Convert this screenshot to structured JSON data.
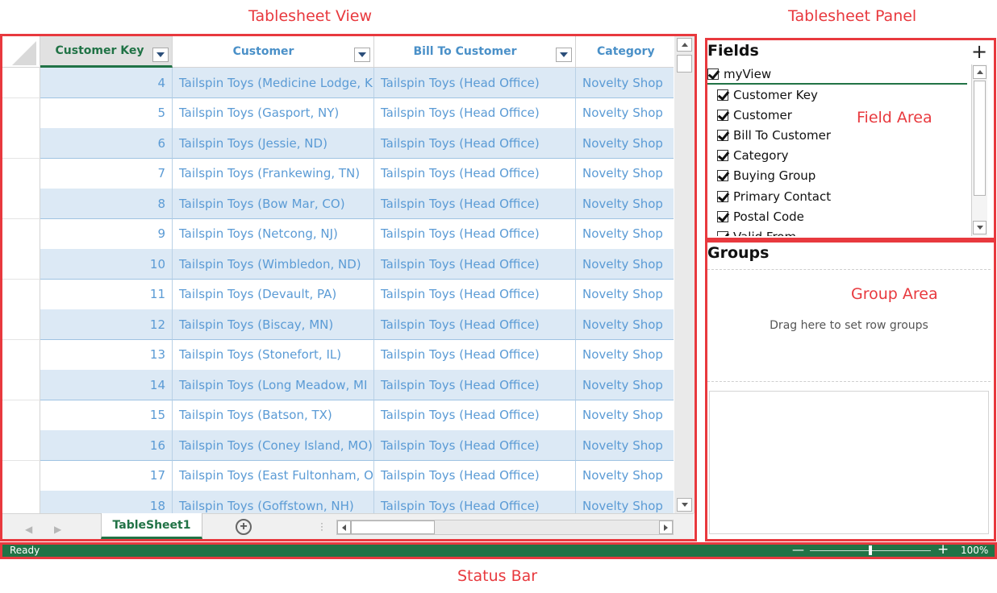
{
  "annotations": {
    "tablesheet_view": "Tablesheet View",
    "tablesheet_panel": "Tablesheet Panel",
    "field_area": "Field Area",
    "group_area": "Group Area",
    "status_bar": "Status Bar"
  },
  "grid": {
    "columns": [
      {
        "label": "Customer Key",
        "selected": true
      },
      {
        "label": "Customer"
      },
      {
        "label": "Bill To Customer"
      },
      {
        "label": "Category"
      }
    ],
    "rows": [
      {
        "key": "4",
        "customer": "Tailspin Toys (Medicine Lodge, K",
        "bill_to": "Tailspin Toys (Head Office)",
        "category": "Novelty Shop"
      },
      {
        "key": "5",
        "customer": "Tailspin Toys (Gasport, NY)",
        "bill_to": "Tailspin Toys (Head Office)",
        "category": "Novelty Shop"
      },
      {
        "key": "6",
        "customer": "Tailspin Toys (Jessie, ND)",
        "bill_to": "Tailspin Toys (Head Office)",
        "category": "Novelty Shop"
      },
      {
        "key": "7",
        "customer": "Tailspin Toys (Frankewing, TN)",
        "bill_to": "Tailspin Toys (Head Office)",
        "category": "Novelty Shop"
      },
      {
        "key": "8",
        "customer": "Tailspin Toys (Bow Mar, CO)",
        "bill_to": "Tailspin Toys (Head Office)",
        "category": "Novelty Shop"
      },
      {
        "key": "9",
        "customer": "Tailspin Toys (Netcong, NJ)",
        "bill_to": "Tailspin Toys (Head Office)",
        "category": "Novelty Shop"
      },
      {
        "key": "10",
        "customer": "Tailspin Toys (Wimbledon, ND)",
        "bill_to": "Tailspin Toys (Head Office)",
        "category": "Novelty Shop"
      },
      {
        "key": "11",
        "customer": "Tailspin Toys (Devault, PA)",
        "bill_to": "Tailspin Toys (Head Office)",
        "category": "Novelty Shop"
      },
      {
        "key": "12",
        "customer": "Tailspin Toys (Biscay, MN)",
        "bill_to": "Tailspin Toys (Head Office)",
        "category": "Novelty Shop"
      },
      {
        "key": "13",
        "customer": "Tailspin Toys (Stonefort, IL)",
        "bill_to": "Tailspin Toys (Head Office)",
        "category": "Novelty Shop"
      },
      {
        "key": "14",
        "customer": "Tailspin Toys (Long Meadow, MI",
        "bill_to": "Tailspin Toys (Head Office)",
        "category": "Novelty Shop"
      },
      {
        "key": "15",
        "customer": "Tailspin Toys (Batson, TX)",
        "bill_to": "Tailspin Toys (Head Office)",
        "category": "Novelty Shop"
      },
      {
        "key": "16",
        "customer": "Tailspin Toys (Coney Island, MO)",
        "bill_to": "Tailspin Toys (Head Office)",
        "category": "Novelty Shop"
      },
      {
        "key": "17",
        "customer": "Tailspin Toys (East Fultonham, O",
        "bill_to": "Tailspin Toys (Head Office)",
        "category": "Novelty Shop"
      },
      {
        "key": "18",
        "customer": "Tailspin Toys (Goffstown, NH)",
        "bill_to": "Tailspin Toys (Head Office)",
        "category": "Novelty Shop"
      }
    ]
  },
  "tabs": {
    "sheet_name": "TableSheet1",
    "add_icon": "plus-circle-icon"
  },
  "panel": {
    "fields_title": "Fields",
    "add_icon": "plus-icon",
    "view_name": "myView",
    "fields": [
      "Customer Key",
      "Customer",
      "Bill To Customer",
      "Category",
      "Buying Group",
      "Primary Contact",
      "Postal Code",
      "Valid From"
    ],
    "groups_title": "Groups",
    "groups_hint": "Drag here to set row groups"
  },
  "status": {
    "text": "Ready",
    "zoom": "100%",
    "zoom_fraction": 0.5
  },
  "colors": {
    "accent_green": "#217346",
    "cell_text_blue": "#5b9bd5",
    "alt_row_blue": "#dce9f5",
    "annotation_red": "#e8393e"
  }
}
